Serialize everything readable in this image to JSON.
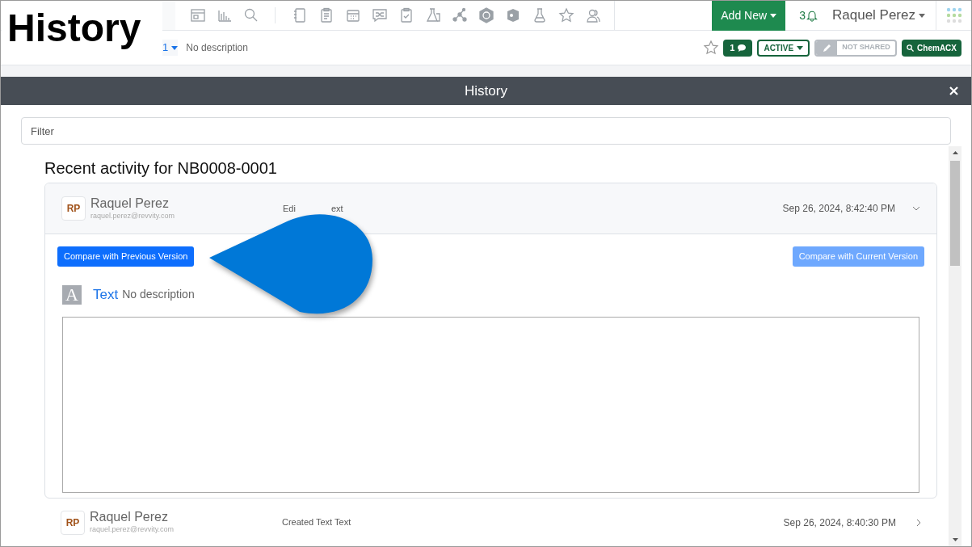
{
  "annotation": {
    "label": "History"
  },
  "toolbar": {
    "add_new": "Add New",
    "notifications": "3",
    "user": "Raquel Perez"
  },
  "record_bar": {
    "version": "1",
    "description": "No description",
    "comments": "1",
    "status": "ACTIVE",
    "sharing": "NOT SHARED",
    "search": "ChemACX"
  },
  "modal": {
    "title": "History",
    "filter": {
      "placeholder": "Filter"
    },
    "heading": "Recent activity for NB0008-0001",
    "entries": [
      {
        "initials": "RP",
        "name": "Raquel Perez",
        "email": "raquel.perez@revvity.com",
        "activity": [
          "Edi",
          "ext"
        ],
        "timestamp": "Sep 26, 2024, 8:42:40 PM",
        "expanded": true,
        "buttons": [
          {
            "label": "Compare with Previous Version",
            "disabled": false
          },
          {
            "label": "Compare with Current Version",
            "disabled": true
          }
        ],
        "section": {
          "glyph": "A",
          "title": "Text",
          "description": "No description"
        }
      },
      {
        "initials": "RP",
        "name": "Raquel Perez",
        "email": "raquel.perez@revvity.com",
        "activity": [
          "Created Text Text"
        ],
        "timestamp": "Sep 26, 2024, 8:40:30 PM",
        "expanded": false
      }
    ]
  }
}
